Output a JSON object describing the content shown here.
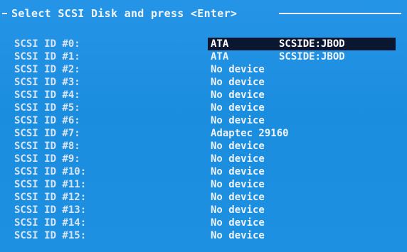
{
  "header": {
    "title": "Select SCSI Disk and press <Enter>"
  },
  "rows": [
    {
      "label": "SCSI ID #0:",
      "device": "ATA",
      "type": "SCSIDE:JBOD",
      "selected": true
    },
    {
      "label": "SCSI ID #1:",
      "device": "ATA",
      "type": "SCSIDE:JBOD",
      "selected": false
    },
    {
      "label": "SCSI ID #2:",
      "device": "No device",
      "type": "",
      "selected": false
    },
    {
      "label": "SCSI ID #3:",
      "device": "No device",
      "type": "",
      "selected": false
    },
    {
      "label": "SCSI ID #4:",
      "device": "No device",
      "type": "",
      "selected": false
    },
    {
      "label": "SCSI ID #5:",
      "device": "No device",
      "type": "",
      "selected": false
    },
    {
      "label": "SCSI ID #6:",
      "device": "No device",
      "type": "",
      "selected": false
    },
    {
      "label": "SCSI ID #7:",
      "device": "Adaptec 29160",
      "type": "",
      "selected": false
    },
    {
      "label": "SCSI ID #8:",
      "device": "No device",
      "type": "",
      "selected": false
    },
    {
      "label": "SCSI ID #9:",
      "device": "No device",
      "type": "",
      "selected": false
    },
    {
      "label": "SCSI ID #10:",
      "device": "No device",
      "type": "",
      "selected": false
    },
    {
      "label": "SCSI ID #11:",
      "device": "No device",
      "type": "",
      "selected": false
    },
    {
      "label": "SCSI ID #12:",
      "device": "No device",
      "type": "",
      "selected": false
    },
    {
      "label": "SCSI ID #13:",
      "device": "No device",
      "type": "",
      "selected": false
    },
    {
      "label": "SCSI ID #14:",
      "device": "No device",
      "type": "",
      "selected": false
    },
    {
      "label": "SCSI ID #15:",
      "device": "No device",
      "type": "",
      "selected": false
    }
  ],
  "colors": {
    "background": "#1f8fe0",
    "text": "#dce8f6",
    "highlight": "#0b1630"
  }
}
